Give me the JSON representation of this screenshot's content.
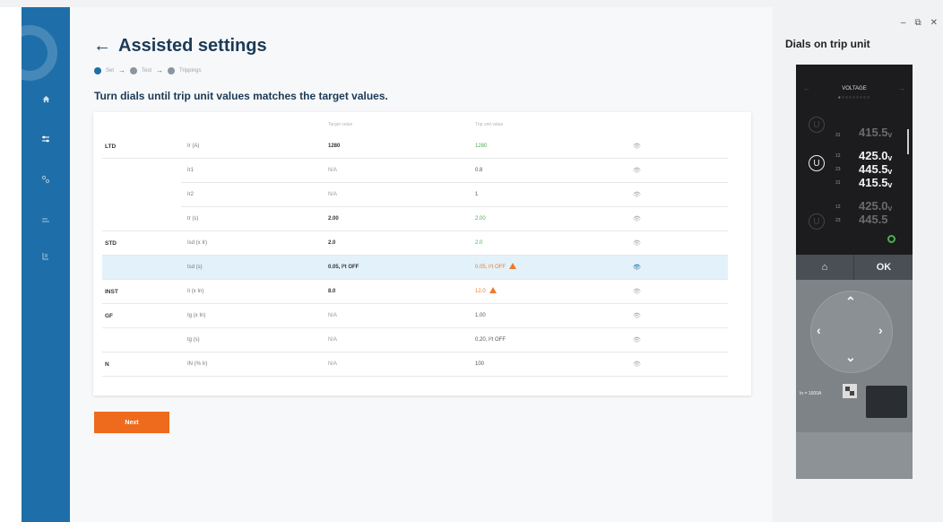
{
  "colors": {
    "sidebar": "#1e6fa9",
    "accent_orange": "#ee6a1c",
    "green": "#4caf50",
    "highlight": "#e3f1fa",
    "title": "#1b3a57"
  },
  "sidebar": {
    "nav_icons": [
      "home-icon",
      "sliders-icon",
      "connection-icon",
      "list-icon",
      "report-icon"
    ]
  },
  "header": {
    "title": "Assisted settings"
  },
  "steps": [
    {
      "num": "1",
      "label": "Set",
      "active": true
    },
    {
      "num": "2",
      "label": "Test",
      "active": false
    },
    {
      "num": "3",
      "label": "Trippings",
      "active": false
    }
  ],
  "instruction": "Turn dials until trip unit values matches the target values.",
  "table": {
    "headers": {
      "target": "Target value",
      "trip": "Trip unit value"
    },
    "rows": [
      {
        "group": "LTD",
        "param": "Ir (A)",
        "target": "1280",
        "trip": "1280"
      },
      {
        "group": "",
        "param": "Ir1",
        "target": "N/A",
        "trip": "0.8"
      },
      {
        "group": "",
        "param": "Ir2",
        "target": "N/A",
        "trip": "1"
      },
      {
        "group": "",
        "param": "tr (s)",
        "target": "2.00",
        "trip": "2.00"
      },
      {
        "group": "STD",
        "param": "Isd (x Ir)",
        "target": "2.0",
        "trip": "2.0"
      },
      {
        "group": "",
        "param": "tsd (s)",
        "target": "0.05, I²t OFF",
        "trip": "0.05, I²t OFF"
      },
      {
        "group": "INST",
        "param": "Ii (x In)",
        "target": "8.0",
        "trip": "12.0"
      },
      {
        "group": "GF",
        "param": "Ig (x In)",
        "target": "N/A",
        "trip": "1.00"
      },
      {
        "group": "",
        "param": "tg (s)",
        "target": "N/A",
        "trip": "0.20, I²t OFF"
      },
      {
        "group": "N",
        "param": "IN (% Ir)",
        "target": "N/A",
        "trip": "100"
      }
    ]
  },
  "next_button": "Next",
  "right_panel": {
    "title": "Dials on trip unit",
    "window_controls": [
      "–",
      "⧉",
      "✕"
    ],
    "device": {
      "screen_title": "VOLTAGE",
      "rows": [
        {
          "sub": "31",
          "value": "415.5ᵥ"
        },
        {
          "sub": "12",
          "value": "425.0ᵥ"
        },
        {
          "sub": "23",
          "value": "445.5ᵥ"
        },
        {
          "sub": "31",
          "value": "415.5ᵥ"
        },
        {
          "sub": "12",
          "value": "425.0ᵥ"
        },
        {
          "sub": "23",
          "value": "445.5"
        }
      ],
      "u_badge": "U",
      "home_key": "⌂",
      "ok_key": "OK",
      "rating": "In = 1600A"
    }
  }
}
